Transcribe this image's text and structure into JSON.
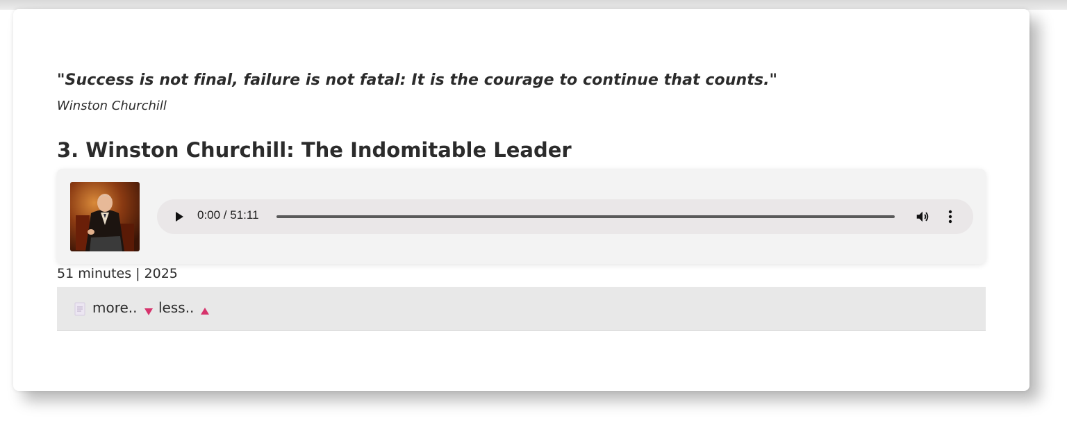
{
  "quote": {
    "text": "\"Success is not final, failure is not fatal: It is the courage to continue that counts.\"",
    "author": "Winston Churchill"
  },
  "episode": {
    "title": "3. Winston Churchill: The Indomitable Leader",
    "duration": "51 minutes",
    "separator": "|",
    "year": "2025"
  },
  "player": {
    "time_display": "0:00 / 51:11",
    "progress": 0,
    "icons": {
      "play": "play-icon",
      "volume": "volume-icon",
      "menu": "more-options-icon",
      "thumbnail": "churchill-portrait"
    }
  },
  "toggles": {
    "more_label": "more..",
    "less_label": "less..",
    "icons": {
      "doc": "document-icon",
      "more": "triangle-down-icon",
      "less": "triangle-up-icon"
    }
  },
  "colors": {
    "text": "#2b2b2b",
    "accent_triangle": "#d6336c",
    "player_bg": "#f3f3f3",
    "audio_bg": "#eae7e8",
    "toggle_bg": "#e8e8e8"
  }
}
